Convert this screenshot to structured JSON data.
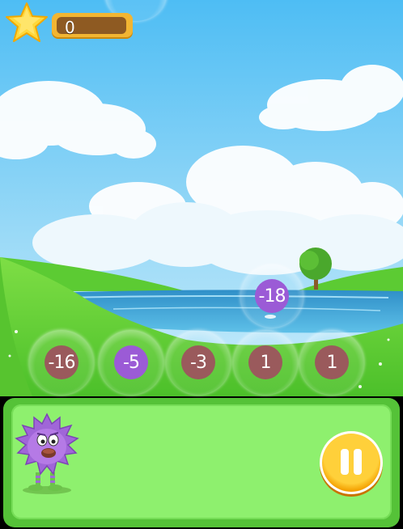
{
  "hud": {
    "score": "0",
    "star_icon": "star-icon"
  },
  "bubbles": [
    {
      "value": "-18",
      "color": "#9b5bd6"
    },
    {
      "value": "-16",
      "color": "#9a5a5c"
    },
    {
      "value": "-5",
      "color": "#9b5bd6"
    },
    {
      "value": "-3",
      "color": "#9a5a5c"
    },
    {
      "value": "1",
      "color": "#9a5a5c"
    },
    {
      "value": "1",
      "color": "#9a5a5c"
    }
  ],
  "controls": {
    "pause_icon": "pause-icon"
  },
  "character": {
    "icon": "purple-monster-icon"
  },
  "colors": {
    "sky": "#56c4f5",
    "grass": "#6fd63a",
    "water": "#3a9fd3",
    "panel": "#8ef06e"
  }
}
